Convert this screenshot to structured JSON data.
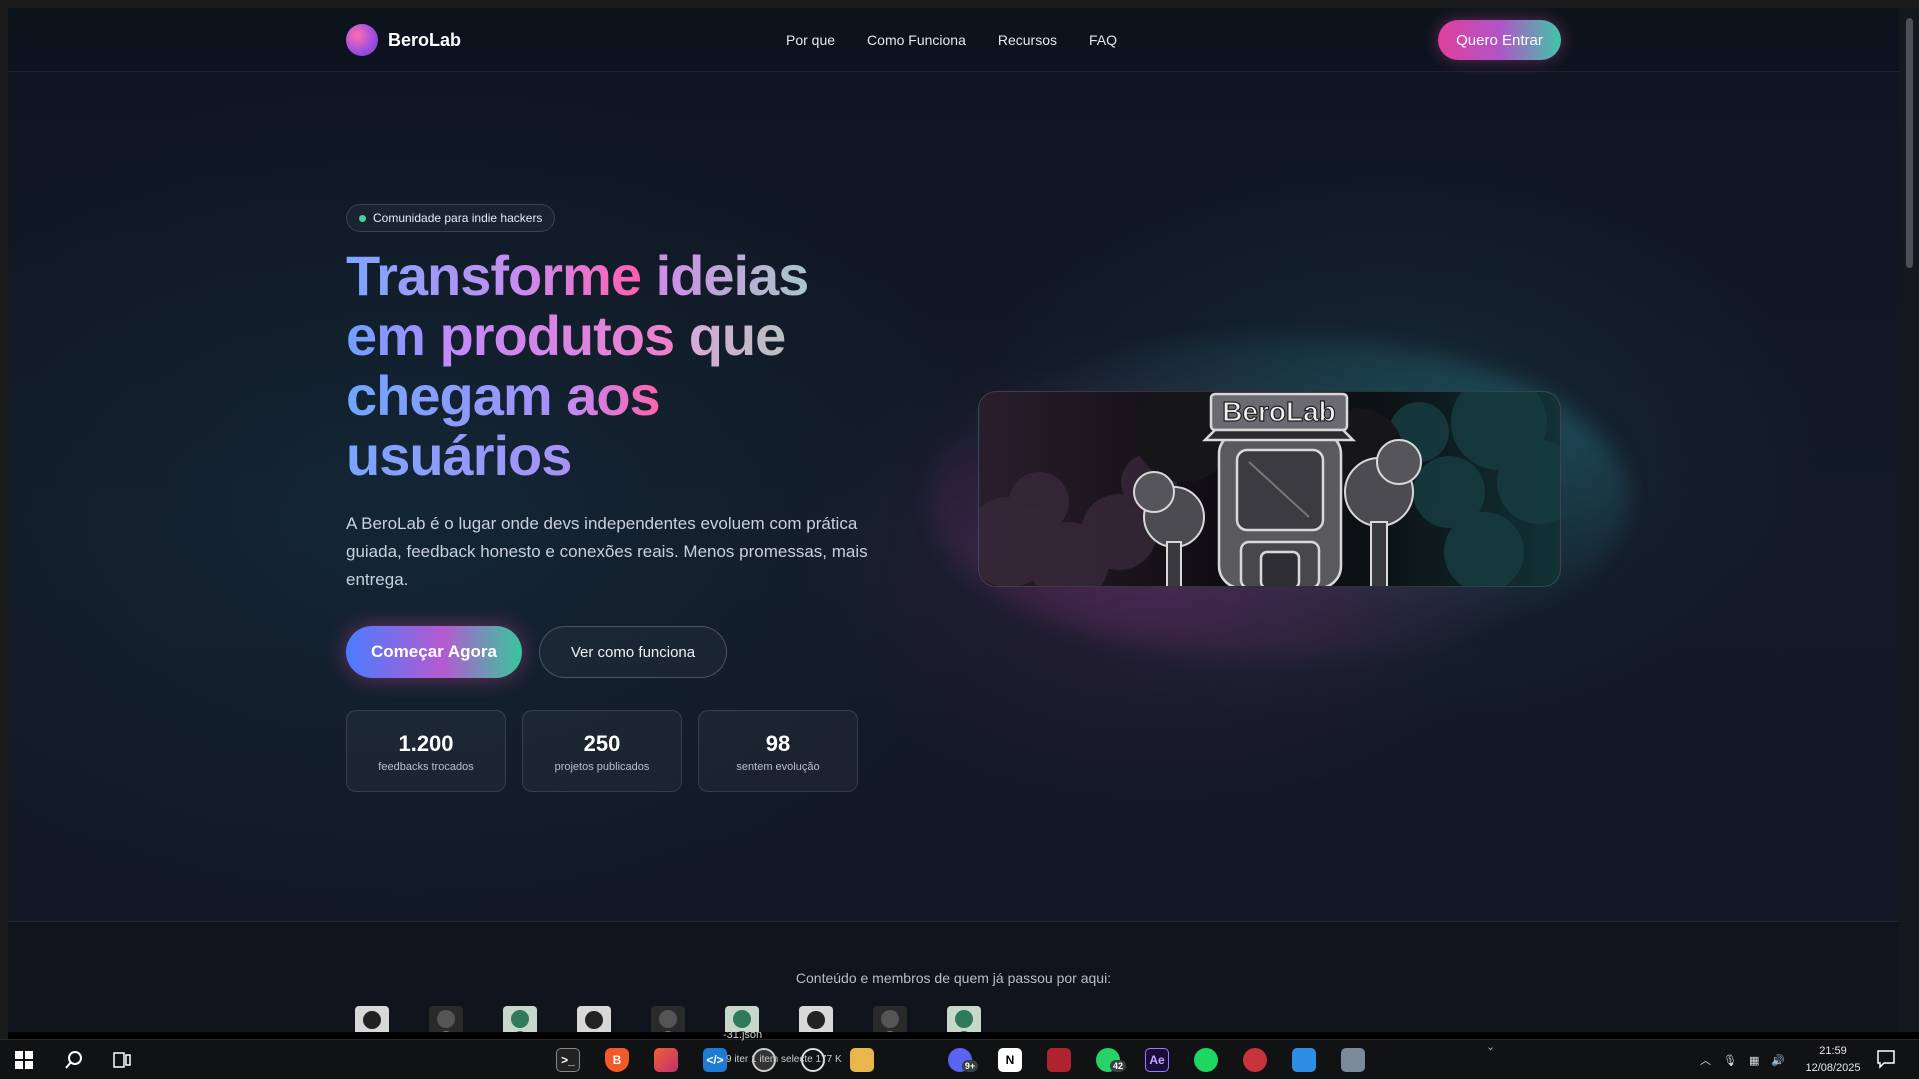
{
  "nav": {
    "logo_text": "BeroLab",
    "links": [
      "Por que",
      "Como Funciona",
      "Recursos",
      "FAQ"
    ],
    "cta": "Quero Entrar"
  },
  "hero": {
    "badge": "Comunidade para indie hackers",
    "headline_words": [
      "Transforme",
      "ideias",
      "em",
      "produtos",
      "que",
      "chegam",
      "aos",
      "usuários"
    ],
    "lead": "A BeroLab é o lugar onde devs independentes evoluem com prática guiada, feedback honesto e conexões reais. Menos promessas, mais entrega.",
    "primary_button": "Começar Agora",
    "secondary_button": "Ver como funciona",
    "image_sign_text": "BeroLab",
    "stats": [
      {
        "value": "1.200",
        "label": "feedbacks trocados"
      },
      {
        "value": "250",
        "label": "projetos publicados"
      },
      {
        "value": "98",
        "label": "sentem evolução"
      }
    ]
  },
  "members": {
    "title": "Conteúdo e membros de quem já passou por aqui:"
  },
  "taskbar": {
    "tooltip": "-31.json",
    "explorer_strip": "9 iter   1 item selecte   177 K",
    "whatsapp_badge": "42",
    "discord_badge": "9+",
    "clock_time": "21:59",
    "clock_date": "12/08/2025"
  },
  "colors": {
    "accent_pink": "#e0409b",
    "accent_purple": "#b055c8",
    "accent_teal": "#3fc7a8",
    "background": "#111823"
  }
}
